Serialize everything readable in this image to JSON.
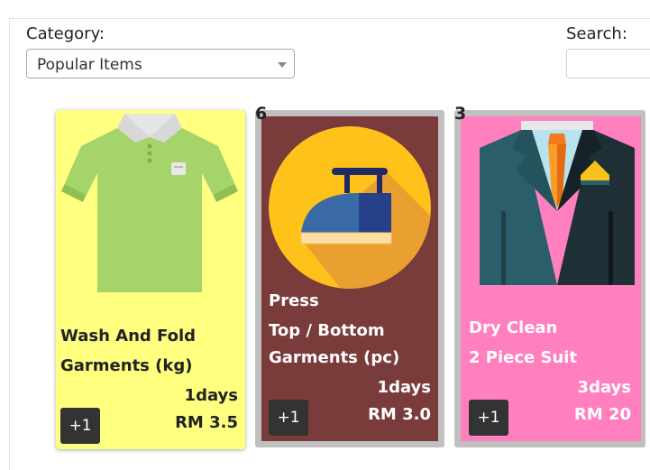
{
  "filters": {
    "category_label": "Category:",
    "category_value": "Popular Items",
    "search_label": "Search:",
    "search_value": ""
  },
  "items": [
    {
      "title_line1": "Wash And Fold",
      "title_line2": "Garments (kg)",
      "duration": "1days",
      "price": "RM 3.5",
      "add_label": "+1",
      "background": "#ffff80",
      "icon": "t-shirt-icon"
    },
    {
      "badge": "6",
      "title_line1": "Press",
      "title_line2": "Top / Bottom",
      "title_line3": "Garments (pc)",
      "duration": "1days",
      "price": "RM 3.0",
      "add_label": "+1",
      "background": "#7a3b3b",
      "icon": "iron-icon"
    },
    {
      "badge": "3",
      "title_line1": "Dry Clean",
      "title_line2": "2 Piece Suit",
      "duration": "3days",
      "price": "RM 20",
      "add_label": "+1",
      "background": "#ff7fbf",
      "icon": "suit-icon"
    }
  ]
}
